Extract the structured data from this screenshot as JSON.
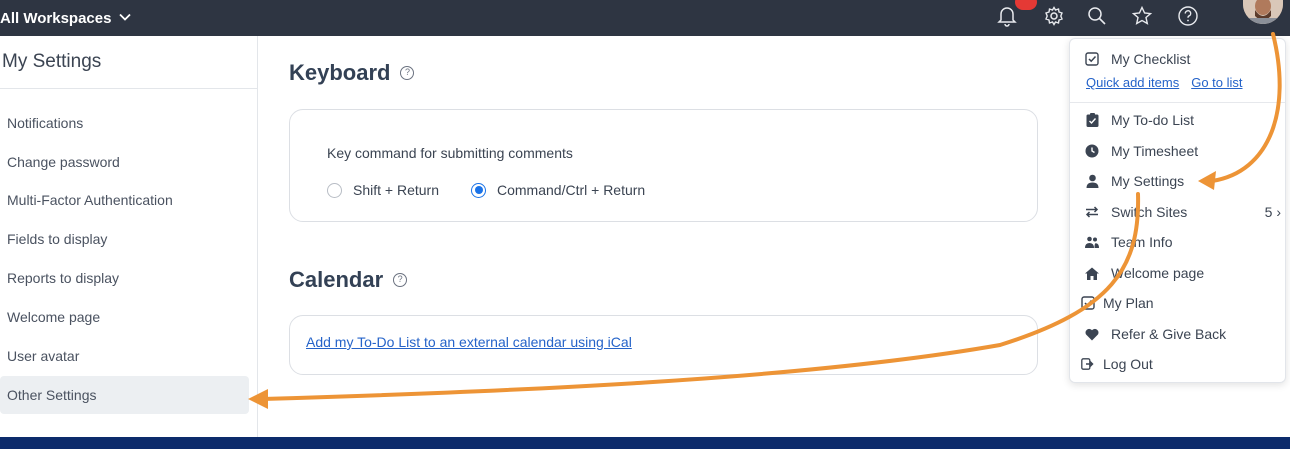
{
  "topbar": {
    "workspace_label": "All Workspaces",
    "icons": [
      "bell-icon",
      "gear-icon",
      "search-icon",
      "star-icon",
      "help-icon"
    ],
    "notification_color": "#e53935"
  },
  "sidebar": {
    "title": "My Settings",
    "items": [
      {
        "label": "Notifications"
      },
      {
        "label": "Change password"
      },
      {
        "label": "Multi-Factor Authentication"
      },
      {
        "label": "Fields to display"
      },
      {
        "label": "Reports to display"
      },
      {
        "label": "Welcome page"
      },
      {
        "label": "User avatar"
      },
      {
        "label": "Other Settings",
        "active": true
      }
    ]
  },
  "main": {
    "keyboard": {
      "title": "Keyboard",
      "help": "?",
      "label": "Key command for submitting comments",
      "options": [
        {
          "label": "Shift + Return",
          "selected": false
        },
        {
          "label": "Command/Ctrl + Return",
          "selected": true
        }
      ]
    },
    "calendar": {
      "title": "Calendar",
      "help": "?",
      "link": "Add my To-Do List to an external calendar using iCal"
    }
  },
  "dropdown": {
    "checklist": {
      "label": "My Checklist",
      "quick_add": "Quick add items",
      "go_to_list": "Go to list"
    },
    "items": [
      {
        "label": "My To-do List",
        "icon": "clipboard-icon"
      },
      {
        "label": "My Timesheet",
        "icon": "clock-icon"
      },
      {
        "label": "My Settings",
        "icon": "user-icon"
      },
      {
        "label": "Switch Sites",
        "icon": "switch-icon",
        "count": "5 ›"
      },
      {
        "label": "Team Info",
        "icon": "team-icon"
      },
      {
        "label": "Welcome page",
        "icon": "home-icon"
      },
      {
        "label": "My Plan",
        "icon": "check-square-icon"
      },
      {
        "label": "Refer & Give Back",
        "icon": "heart-icon"
      },
      {
        "label": "Log Out",
        "icon": "logout-icon"
      }
    ]
  },
  "colors": {
    "accent": "#1a73e8",
    "link": "#2563c9",
    "arrow": "#ed9436",
    "topbar": "#2e3542",
    "footer": "#0c2b6b"
  }
}
